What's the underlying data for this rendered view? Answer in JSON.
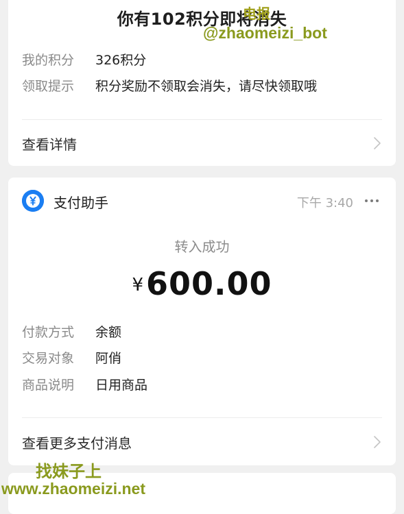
{
  "points_card": {
    "title": "你有102积分即将消失",
    "rows": [
      {
        "label": "我的积分",
        "value": "326积分"
      },
      {
        "label": "领取提示",
        "value": "积分奖励不领取会消失，请尽快领取哦"
      }
    ],
    "detail_link": "查看详情"
  },
  "payment_card": {
    "app_name": "支付助手",
    "time": "下午 3:40",
    "status": "转入成功",
    "currency": "¥",
    "amount": "600.00",
    "rows": [
      {
        "label": "付款方式",
        "value": "余额"
      },
      {
        "label": "交易对象",
        "value": "阿俏"
      },
      {
        "label": "商品说明",
        "value": "日用商品"
      }
    ],
    "more_link": "查看更多支付消息"
  },
  "watermarks": {
    "top_cn": "电报",
    "top_en": "@zhaomeizi_bot",
    "bottom_cn": "找妹子上",
    "bottom_en": "www.zhaomeizi.net"
  },
  "icons": {
    "app_icon": "yuan-coin-icon",
    "more_icon": "more-dots-icon",
    "chevron": "chevron-right-icon"
  },
  "colors": {
    "app_icon_blue": "#1b7ef2",
    "watermark": "#8a9a1e",
    "background": "#f0f0f0"
  }
}
